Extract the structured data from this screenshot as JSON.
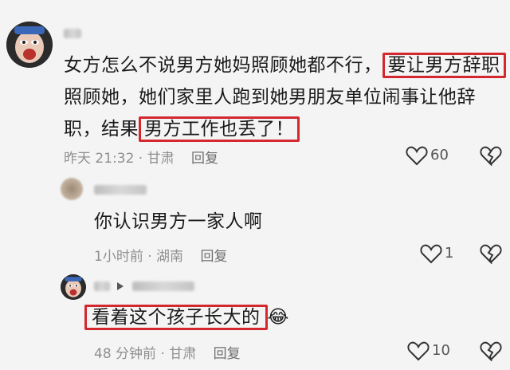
{
  "comments": [
    {
      "line1_pre": "女方怎么不说男方她妈照顾她都不行，",
      "line1_hl": "要让男方辞职",
      "line2": "照顾她，她们家里人跑到她男朋友单位闹事让他辞",
      "line3_pre": "职，结果",
      "line3_hl": "男方工作也丢了！",
      "time": "昨天 21:32 · 甘肃",
      "reply_label": "回复",
      "likes": "60"
    },
    {
      "text": "你认识男方一家人啊",
      "time": "1小时前 · 湖南",
      "reply_label": "回复",
      "likes": "1"
    },
    {
      "text_hl": "看着这个孩子长大的",
      "emoji": "😂",
      "time": "48 分钟前 · 甘肃",
      "reply_label": "回复",
      "likes": "10"
    }
  ],
  "icons": {
    "heart": "heart-icon",
    "dislike": "broken-heart-icon",
    "play": "play-icon"
  },
  "colors": {
    "highlight": "#d2282e",
    "meta": "#8f8f8f",
    "background": "#f4f4f4"
  }
}
